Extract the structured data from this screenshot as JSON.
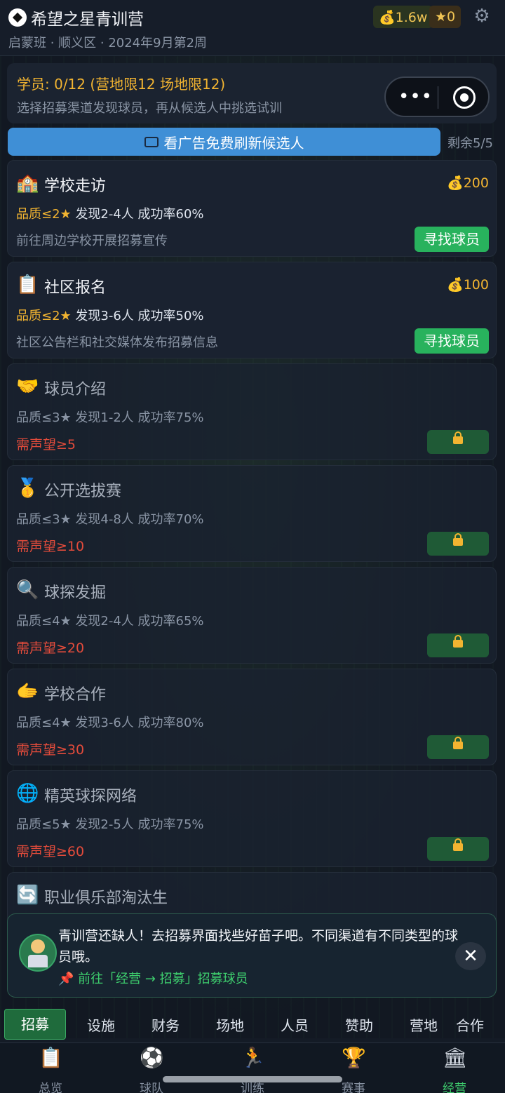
{
  "header": {
    "title": "希望之星青训营",
    "subtitle": "启蒙班 · 顺义区 · 2024年9月第2周",
    "coins": "💰1.6w",
    "stars": "★0",
    "settings_icon": "gear-icon"
  },
  "info": {
    "title": "学员: 0/12 (营地限12 场地限12)",
    "desc": "选择招募渠道发现球员，再从候选人中挑选试训"
  },
  "capsule": {
    "more": "•••"
  },
  "ad": {
    "label": "看广告免费刷新候选人",
    "remaining": "剩余5/5"
  },
  "channels": [
    {
      "icon": "🏫",
      "name": "学校走访",
      "cost": "💰200",
      "quality": "品质≤2★",
      "stats": "发现2-4人  成功率60%",
      "desc": "前往周边学校开展招募宣传",
      "action": "寻找球员"
    },
    {
      "icon": "📋",
      "name": "社区报名",
      "cost": "💰100",
      "quality": "品质≤2★",
      "stats": "发现3-6人  成功率50%",
      "desc": "社区公告栏和社交媒体发布招募信息",
      "action": "寻找球员"
    },
    {
      "icon": "🤝",
      "name": "球员介绍",
      "quality": "品质≤3★",
      "stats": "发现1-2人  成功率75%",
      "req": "需声望≥5"
    },
    {
      "icon": "🥇",
      "name": "公开选拔赛",
      "quality": "品质≤3★",
      "stats": "发现4-8人  成功率70%",
      "req": "需声望≥10"
    },
    {
      "icon": "🔍",
      "name": "球探发掘",
      "quality": "品质≤4★",
      "stats": "发现2-4人  成功率65%",
      "req": "需声望≥20"
    },
    {
      "icon": "🫱",
      "name": "学校合作",
      "quality": "品质≤4★",
      "stats": "发现3-6人  成功率80%",
      "req": "需声望≥30"
    },
    {
      "icon": "🌐",
      "name": "精英球探网络",
      "quality": "品质≤5★",
      "stats": "发现2-5人  成功率75%",
      "req": "需声望≥60"
    },
    {
      "icon": "🔄",
      "name": "职业俱乐部淘汰生"
    }
  ],
  "toast": {
    "message": "青训营还缺人！去招募界面找些好苗子吧。不同渠道有不同类型的球员哦。",
    "link": "📌 前往「经营 → 招募」招募球员",
    "close": "✕"
  },
  "subtabs": [
    "招募",
    "设施",
    "财务",
    "场地",
    "人员",
    "赞助",
    "营地",
    "合作"
  ],
  "nav": [
    {
      "icon": "📋",
      "label": "总览"
    },
    {
      "icon": "⚽",
      "label": "球队"
    },
    {
      "icon": "🏃",
      "label": "训练"
    },
    {
      "icon": "🏆",
      "label": "赛事"
    },
    {
      "icon": "🏛",
      "label": "经营"
    }
  ],
  "colors": {
    "accent_green": "#28b25d",
    "gold": "#f2b431",
    "danger": "#e24b3b",
    "ad_blue": "#3f8fd6"
  }
}
